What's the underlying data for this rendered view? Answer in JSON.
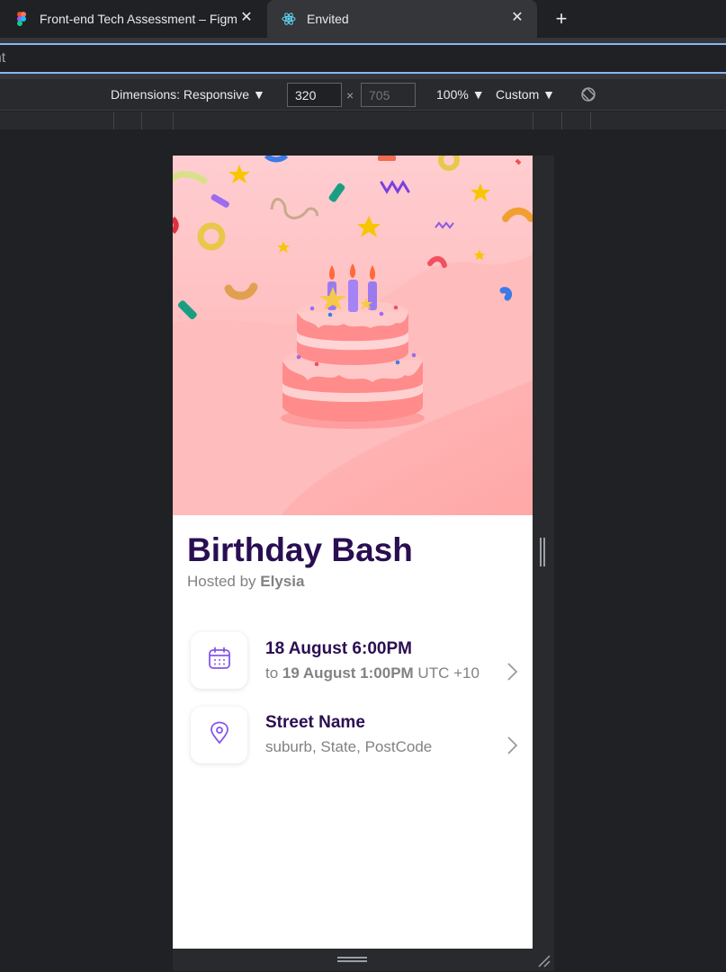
{
  "browser": {
    "tabs": [
      {
        "label": "Front-end Tech Assessment – Figma",
        "icon": "figma-icon"
      },
      {
        "label": "Envited",
        "icon": "react-icon",
        "active": true
      }
    ],
    "new_tab_symbol": "+",
    "close_symbol": "✕",
    "address_text": "vent"
  },
  "devtools": {
    "dimensions_label": "Dimensions: Responsive ▼",
    "width": "320",
    "height_placeholder": "705",
    "times": "×",
    "zoom": "100% ▼",
    "throttle": "Custom ▼"
  },
  "event": {
    "title": "Birthday Bash",
    "hosted_by_prefix": "Hosted by ",
    "host_name": "Elysia",
    "date": {
      "title": "18 August 6:00PM",
      "to_prefix": "to ",
      "end": "19 August 1:00PM",
      "timezone": " UTC +10"
    },
    "location": {
      "title": "Street Name",
      "sub": "suburb, State, PostCode"
    }
  },
  "colors": {
    "title": "#2a0e52",
    "muted": "#828282",
    "accent": "#8456ec",
    "hero_bg": "#ffc7c7"
  }
}
